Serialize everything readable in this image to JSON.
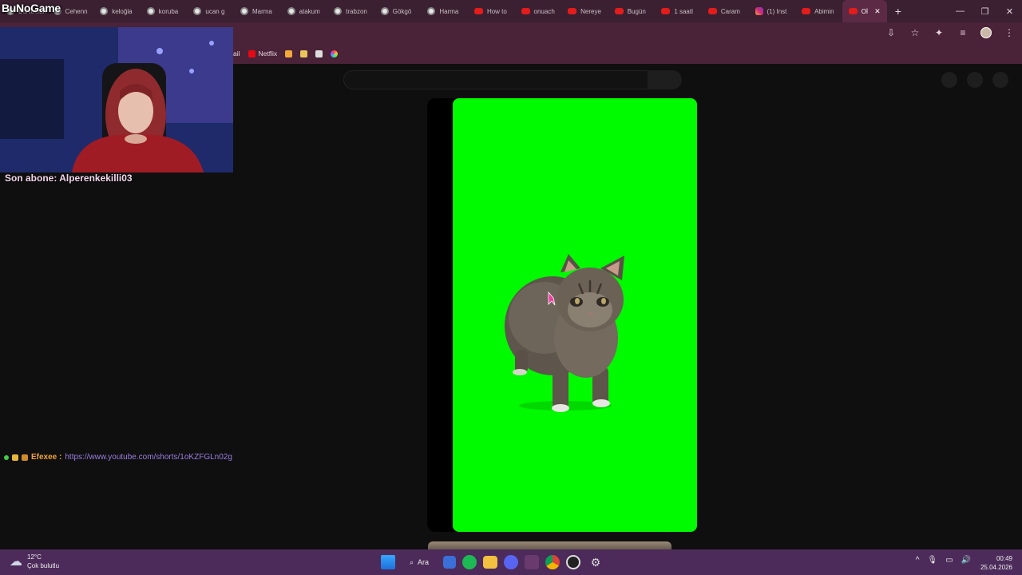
{
  "browser": {
    "tabs": [
      {
        "label": "BuNoGame",
        "icon": "google-icon"
      },
      {
        "label": "Cehenn",
        "icon": "google-icon"
      },
      {
        "label": "keloğla",
        "icon": "google-icon"
      },
      {
        "label": "koruba",
        "icon": "google-icon"
      },
      {
        "label": "ucan g",
        "icon": "google-icon"
      },
      {
        "label": "Marma",
        "icon": "google-icon"
      },
      {
        "label": "atakum",
        "icon": "google-icon"
      },
      {
        "label": "trabzon",
        "icon": "google-icon"
      },
      {
        "label": "Gökgö",
        "icon": "google-icon"
      },
      {
        "label": "Harma",
        "icon": "google-icon"
      },
      {
        "label": "How to",
        "icon": "youtube-icon"
      },
      {
        "label": "onuach",
        "icon": "youtube-icon"
      },
      {
        "label": "Nereye",
        "icon": "youtube-icon"
      },
      {
        "label": "Bugün",
        "icon": "youtube-icon"
      },
      {
        "label": "1 saatl",
        "icon": "youtube-icon"
      },
      {
        "label": "Caram",
        "icon": "youtube-icon"
      },
      {
        "label": "(1) Inst",
        "icon": "instagram-icon"
      },
      {
        "label": "Abimin",
        "icon": "youtube-icon"
      },
      {
        "label": "Oİ",
        "icon": "youtube-icon",
        "active": true
      }
    ],
    "new_tab": "+",
    "window_controls": [
      "—",
      "❐",
      "✕"
    ],
    "toolbar_icons": [
      "install-icon",
      "star-icon",
      "extensions-icon",
      "media-icon",
      "profile-avatar",
      "menu-icon"
    ],
    "bookmarks": [
      {
        "label": "ail"
      },
      {
        "label": "Netflix"
      },
      {
        "label": ""
      },
      {
        "label": ""
      },
      {
        "label": ""
      },
      {
        "label": ""
      }
    ]
  },
  "stream_overlay": {
    "brand": "BuNoGame",
    "subscriber_text": "Son abone: Alperenkekilli03",
    "chat": {
      "user": "Efexee :",
      "message": "https://www.youtube.com/shorts/1oKZFGLn02g"
    }
  },
  "taskbar": {
    "weather_temp": "12°C",
    "weather_desc": "Çok bulutlu",
    "search_label": "Ara",
    "time": "00:49",
    "date": "25.04.2026"
  },
  "colors": {
    "video_bg": "#00fa00",
    "tab_strip": "#3a2030",
    "toolbar": "#4a2338",
    "taskbar": "#4c2b5a"
  }
}
